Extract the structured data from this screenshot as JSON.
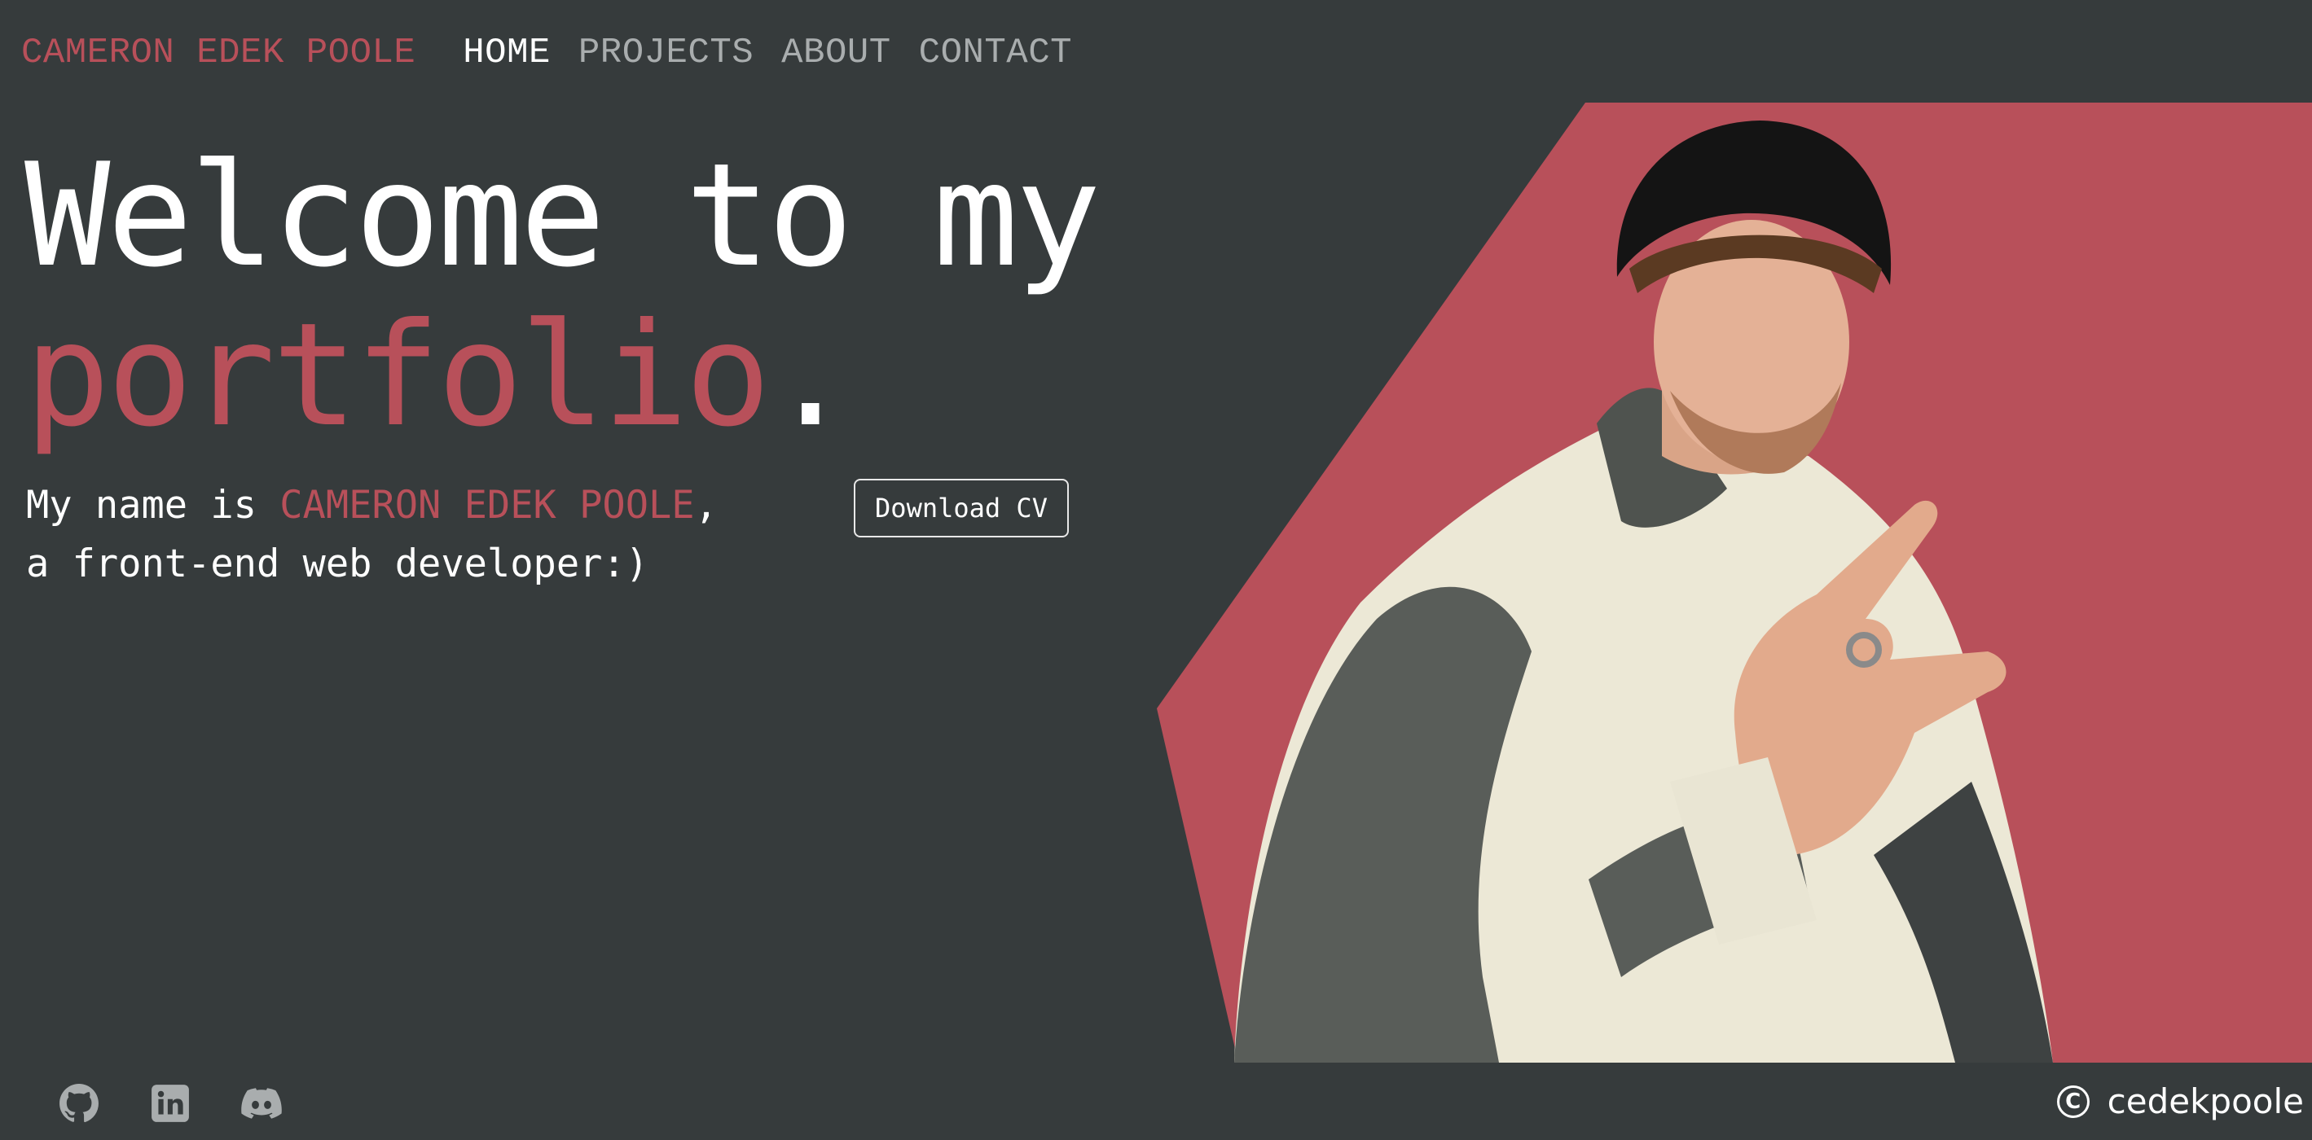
{
  "nav": {
    "brand": "CAMERON EDEK POOLE",
    "links": [
      {
        "label": "HOME",
        "active": true
      },
      {
        "label": "PROJECTS",
        "active": false
      },
      {
        "label": "ABOUT",
        "active": false
      },
      {
        "label": "CONTACT",
        "active": false
      }
    ]
  },
  "hero": {
    "headline_line1": "Welcome to my",
    "headline_accent": "portfolio",
    "headline_end": ".",
    "intro_prefix": "My name is ",
    "intro_name": "CAMERON EDEK POOLE",
    "intro_suffix": ",",
    "intro_line2": "a front-end web developer:)",
    "cv_button_label": "Download CV",
    "photo_icon": "portrait-photo"
  },
  "footer": {
    "social": [
      {
        "icon": "github-icon"
      },
      {
        "icon": "linkedin-icon"
      },
      {
        "icon": "discord-icon"
      }
    ],
    "copyright_symbol": "C",
    "copyright_text": "cedekpoole"
  },
  "colors": {
    "background": "#363b3c",
    "accent": "#b8505a",
    "text": "#ffffff",
    "muted_link": "#a9adae"
  }
}
